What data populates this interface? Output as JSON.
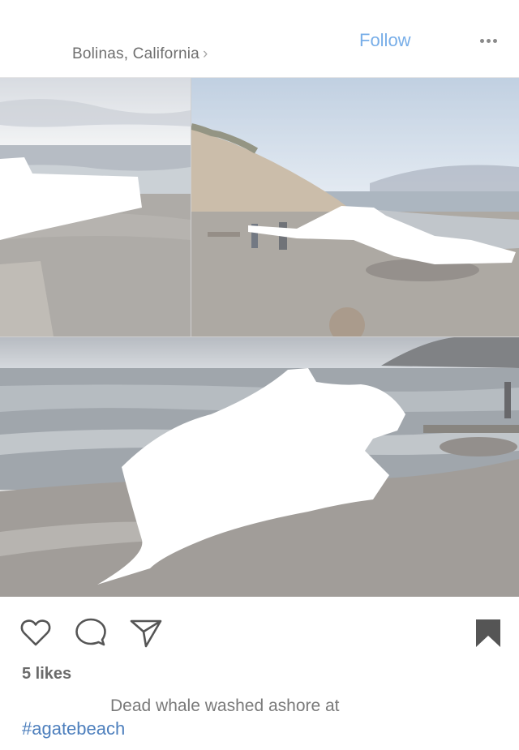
{
  "header": {
    "location": "Bolinas, California",
    "location_chevron": "›",
    "follow_label": "Follow",
    "more_icon": "more-horizontal-icon"
  },
  "post": {
    "photo_count": 3,
    "likes": "5 likes",
    "caption": "Dead whale washed ashore at",
    "hashtag": "#agatebeach"
  },
  "actions": {
    "icons": [
      "heart-icon",
      "comment-icon",
      "share-icon",
      "bookmark-icon"
    ]
  },
  "colors": {
    "follow": "#78aee8",
    "hashtag": "#4d7fbd",
    "icon": "#555555"
  }
}
